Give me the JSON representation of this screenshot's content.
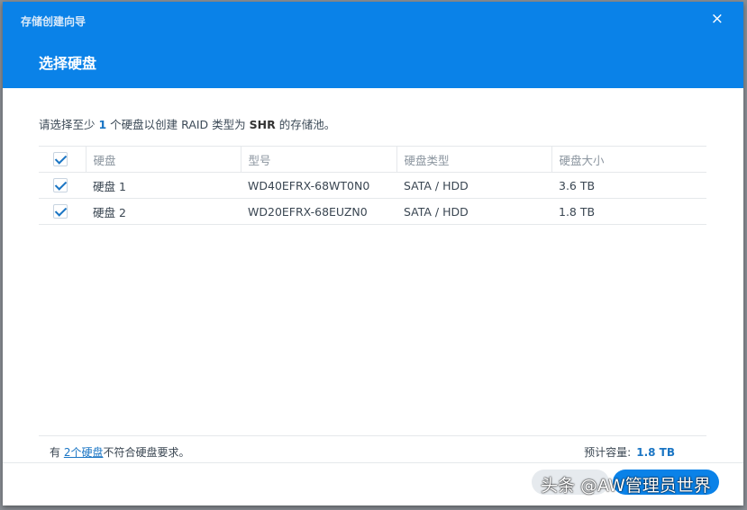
{
  "window": {
    "title": "存储创建向导",
    "close_icon": "×"
  },
  "step_title": "选择硬盘",
  "description": {
    "pre": "请选择至少 ",
    "count": "1",
    "mid": " 个硬盘以创建 RAID 类型为 ",
    "raid": "SHR",
    "post": " 的存储池。"
  },
  "table": {
    "headers": [
      "硬盘",
      "型号",
      "硬盘类型",
      "硬盘大小"
    ],
    "rows": [
      {
        "name": "硬盘 1",
        "model": "WD40EFRX-68WT0N0",
        "type": "SATA / HDD",
        "size": "3.6 TB",
        "checked": true
      },
      {
        "name": "硬盘 2",
        "model": "WD20EFRX-68EUZN0",
        "type": "SATA / HDD",
        "size": "1.8 TB",
        "checked": true
      }
    ]
  },
  "footer": {
    "pre": "有 ",
    "link": "2个硬盘",
    "post": "不符合硬盘要求。",
    "capacity_label": "预计容量:",
    "capacity_value": "1.8 TB"
  },
  "watermark": "头条 @AW管理员世界"
}
